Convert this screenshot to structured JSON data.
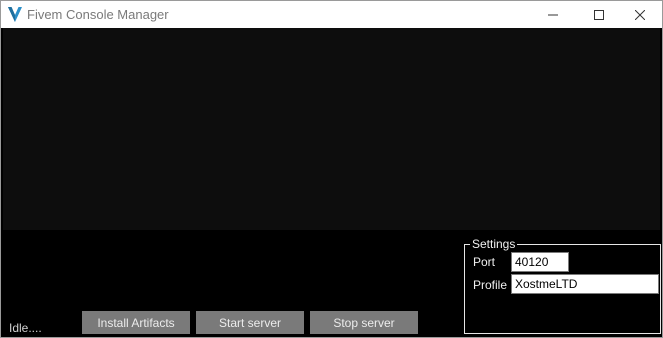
{
  "window": {
    "title": "Fivem Console Manager",
    "icon": "v-logo-icon",
    "controls": [
      "minimize-icon",
      "maximize-icon",
      "close-icon"
    ]
  },
  "console": {
    "lines": []
  },
  "status": {
    "text": "Idle...."
  },
  "actions": {
    "install_label": "Install Artifacts",
    "start_label": "Start server",
    "stop_label": "Stop server"
  },
  "settings": {
    "legend": "Settings",
    "port_label": "Port",
    "port_value": "40120",
    "profile_label": "Profile",
    "profile_value": "XostmeLTD"
  },
  "colors": {
    "background": "#000000",
    "console_background": "#0d0d0d",
    "button": "#7a7a7a",
    "accent_icon": "#2a8fc9"
  }
}
